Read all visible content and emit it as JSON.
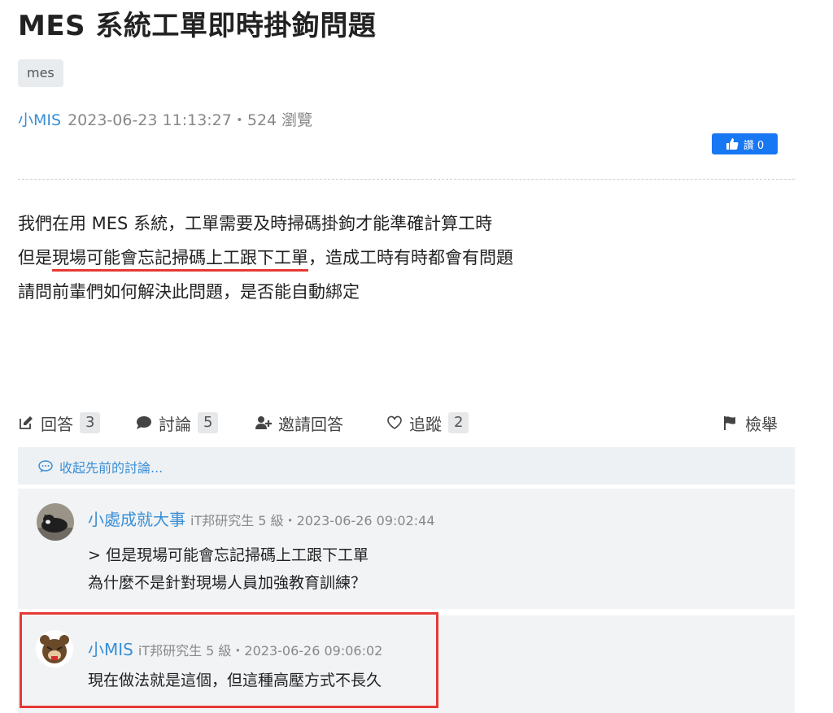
{
  "question": {
    "title": "MES 系統工單即時掛鉤問題",
    "tag": "mes",
    "author": "小MIS",
    "meta": "2023-06-23 11:13:27・524 瀏覽",
    "like_label": "讚 0",
    "body": {
      "line1": "我們在用 MES 系統，工單需要及時掃碼掛鉤才能準確計算工時",
      "line2_prefix": "但是",
      "line2_underlined": "現場可能會忘記掃碼上工跟下工單",
      "line2_suffix": "，造成工時有時都會有問題",
      "line3": "請問前輩們如何解決此問題，是否能自動綁定"
    }
  },
  "actions": {
    "answer_label": "回答",
    "answer_count": "3",
    "discuss_label": "討論",
    "discuss_count": "5",
    "invite_label": "邀請回答",
    "follow_label": "追蹤",
    "follow_count": "2",
    "report_label": "檢舉"
  },
  "discussion": {
    "collapse_label": "收起先前的討論...",
    "comments": [
      {
        "name": "小處成就大事",
        "meta": "iT邦研究生 5 級・2023-06-26 09:02:44",
        "lines": [
          "> 但是現場可能會忘記掃碼上工跟下工單",
          "為什麼不是針對現場人員加強教育訓練？"
        ]
      },
      {
        "name": "小MIS",
        "meta": "iT邦研究生 5 級・2023-06-26 09:06:02",
        "lines": [
          "現在做法就是這個，但這種高壓方式不長久"
        ]
      }
    ]
  },
  "colors": {
    "accent": "#3a8fd6",
    "highlight": "#e53935",
    "like_button": "#1877f2"
  }
}
